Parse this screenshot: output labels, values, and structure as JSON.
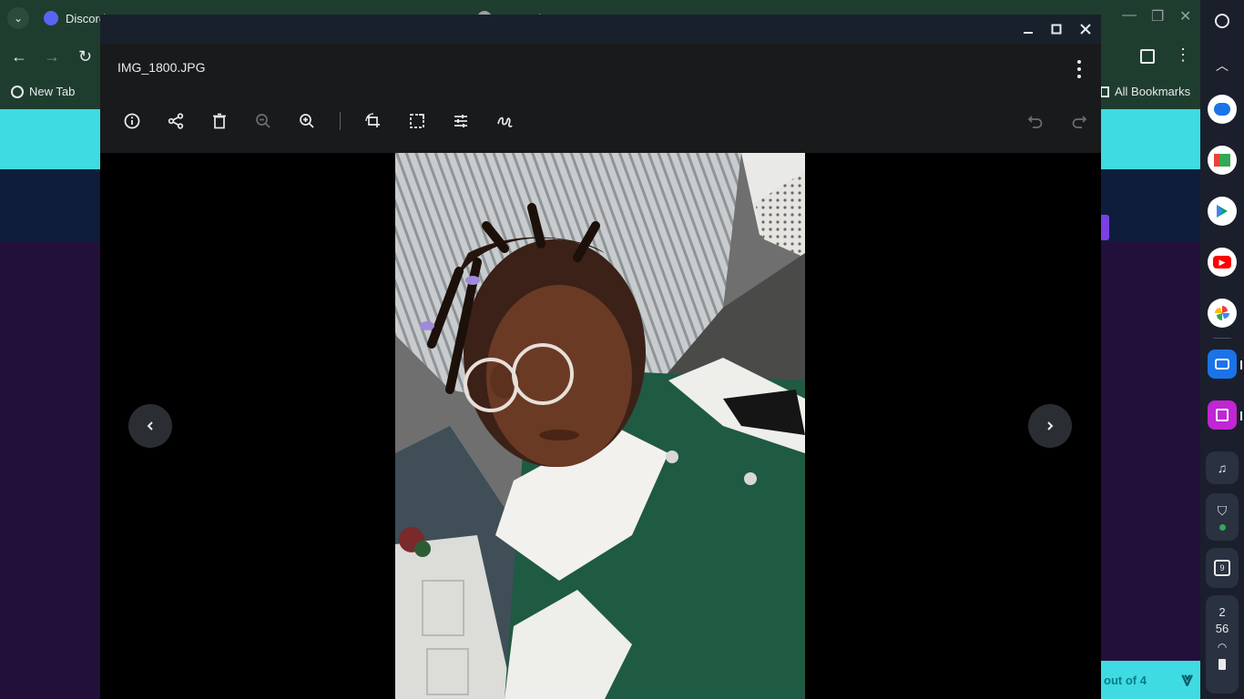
{
  "browser": {
    "tabs": [
      {
        "label": "Discord"
      },
      {
        "label": ""
      },
      {
        "label": "New Tab"
      }
    ],
    "bookmarks": {
      "new_tab": "New Tab",
      "all_bookmarks": "All Bookmarks"
    },
    "download_text": "out of 4"
  },
  "gallery": {
    "file_name": "IMG_1800.JPG",
    "toolbar": {
      "info": "info-icon",
      "share": "share-icon",
      "delete": "delete-icon",
      "zoom_out": "zoom-out-icon",
      "zoom_in": "zoom-in-icon",
      "rotate_crop": "crop-rotate-icon",
      "rescale": "rescale-icon",
      "adjust": "lighting-icon",
      "annotate": "annotate-icon",
      "undo": "undo-icon",
      "redo": "redo-icon"
    },
    "colors": {
      "header_bg": "#191a1c",
      "titlebar_bg": "#18212b",
      "canvas_bg": "#000000"
    }
  },
  "shelf": {
    "date_number": "9",
    "time_hour": "2",
    "time_minute": "56"
  }
}
